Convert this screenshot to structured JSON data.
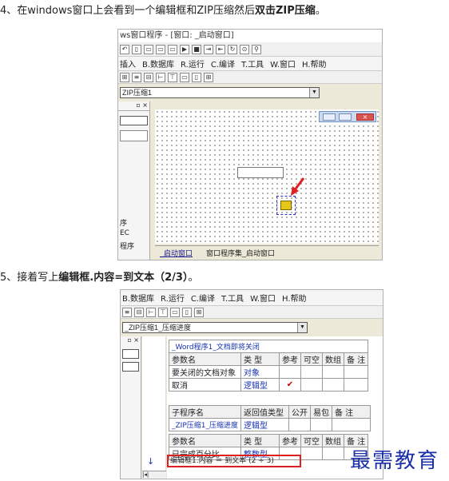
{
  "step4": {
    "prefix": "4、在windows窗口上会看到一个编辑框和ZIP压缩然后",
    "bold": "双击ZIP压缩",
    "suffix": "。"
  },
  "shot1": {
    "title": "ws窗口程序 - [窗口: _启动窗口]",
    "menu": [
      "插入",
      "B.数据库",
      "R.运行",
      "C.编译",
      "T.工具",
      "W.窗口",
      "H.帮助"
    ],
    "combo_value": "ZIP压缩1",
    "left_labels": [
      "序",
      "EC",
      "程序"
    ],
    "tabs": [
      "_启动窗口",
      "窗口程序集_启动窗口"
    ]
  },
  "step5": {
    "prefix": "5、接着写上",
    "bold": "编辑框.内容=到文本（2/3）",
    "suffix": "。"
  },
  "shot2": {
    "menu": [
      "B.数据库",
      "R.运行",
      "C.编译",
      "T.工具",
      "W.窗口",
      "H.帮助"
    ],
    "combo_value": "_ZIP压缩1_压缩进度",
    "table1": {
      "title": "_Word程序1_文档即将关闭",
      "header": [
        "参数名",
        "类 型",
        "参考",
        "可空",
        "数组",
        "备 注"
      ],
      "rows": [
        [
          "要关闭的文档对象",
          "对象",
          "",
          "",
          "",
          ""
        ],
        [
          "取消",
          "逻辑型",
          "✔",
          "",
          "",
          ""
        ]
      ]
    },
    "table2": {
      "header": [
        "子程序名",
        "返回值类型",
        "公开",
        "易包",
        "备 注"
      ],
      "row": [
        "_ZIP压缩1_压缩进度",
        "逻辑型",
        "",
        "",
        ""
      ]
    },
    "table3": {
      "header": [
        "参数名",
        "类 型",
        "参考",
        "可空",
        "数组",
        "备 注"
      ],
      "row": [
        "已完成百分比",
        "整数型",
        "",
        "",
        "",
        ""
      ]
    },
    "code_line": "编辑框1.内容 ＝ 到文本 (2 ÷ 3)"
  },
  "watermark": "最需教育"
}
